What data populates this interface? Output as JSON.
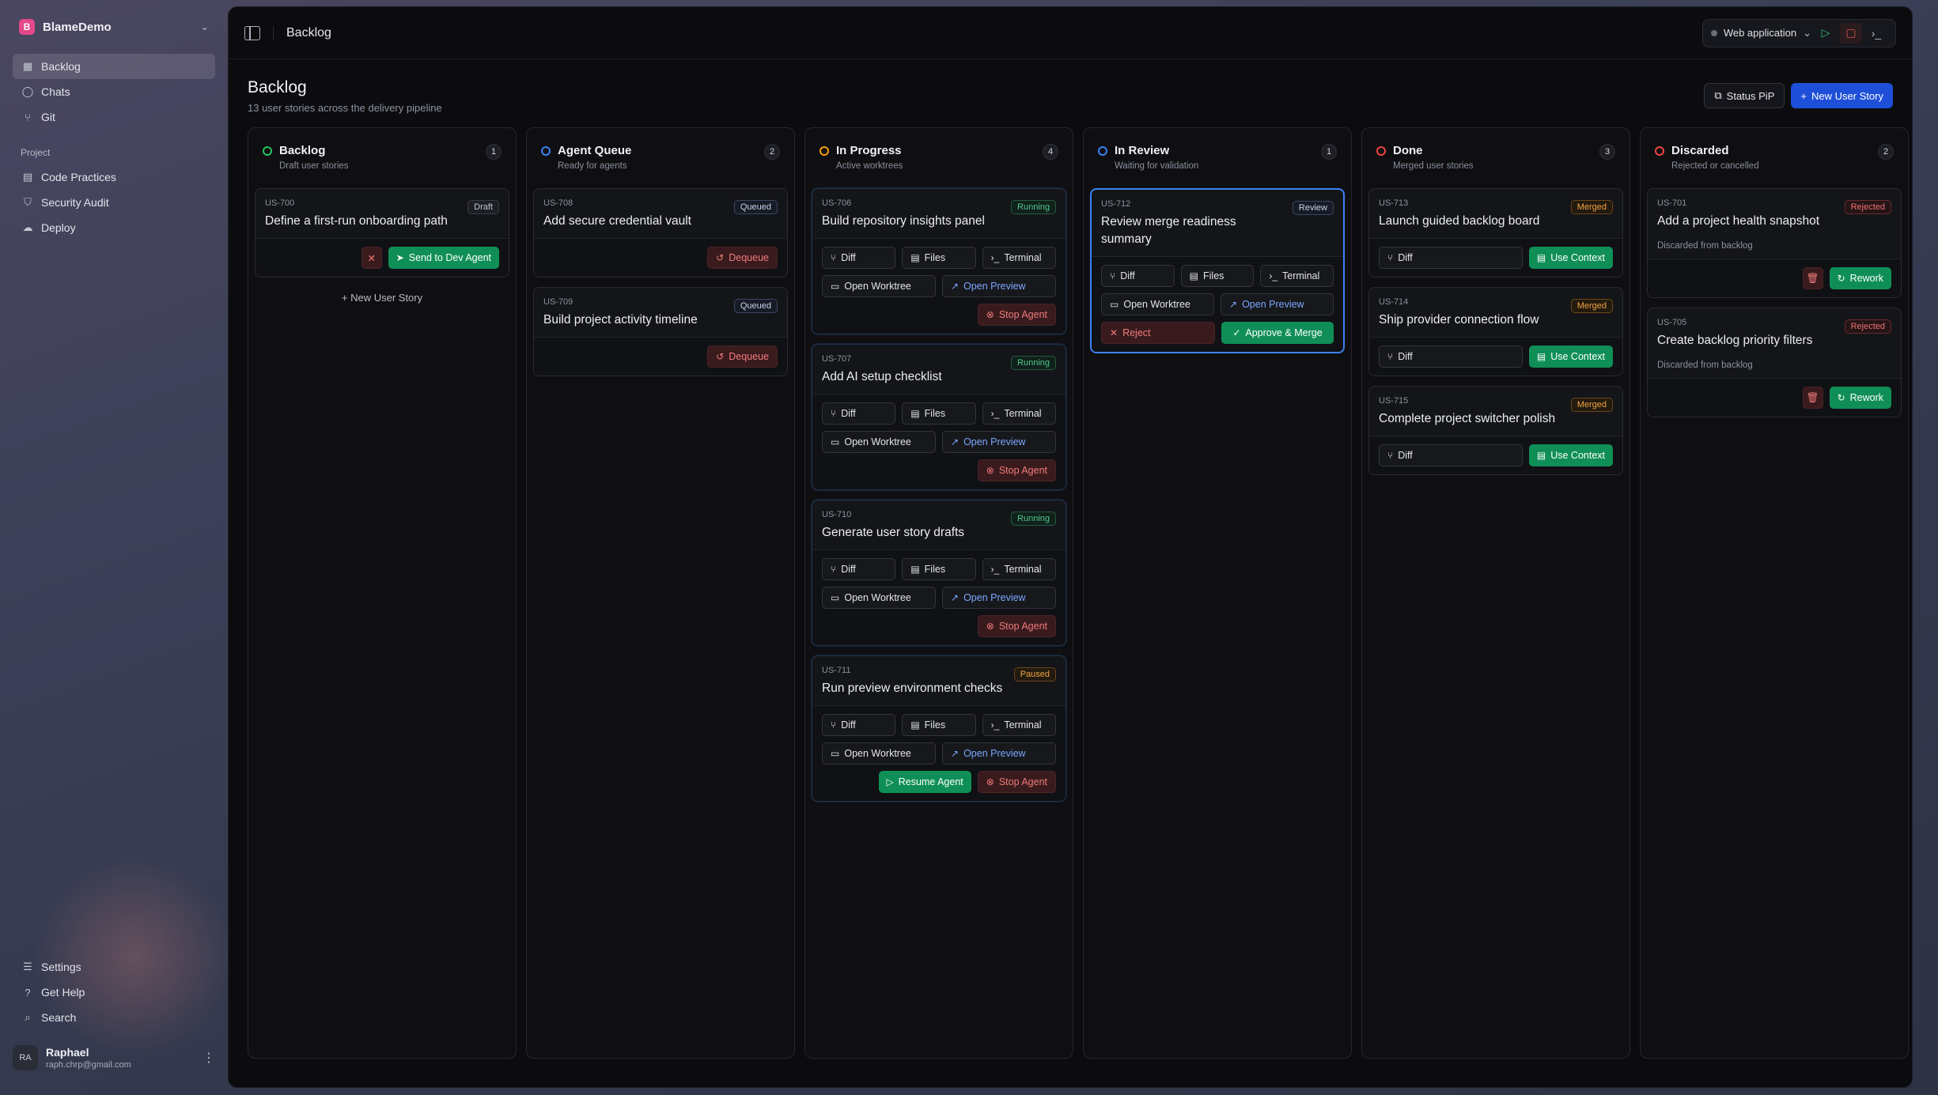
{
  "workspace": {
    "name": "BlameDemo",
    "logo_letter": "B"
  },
  "nav": {
    "items": [
      {
        "label": "Backlog",
        "icon": "board-icon"
      },
      {
        "label": "Chats",
        "icon": "chat-icon"
      },
      {
        "label": "Git",
        "icon": "git-icon"
      }
    ],
    "section_label": "Project",
    "project_items": [
      {
        "label": "Code Practices",
        "icon": "book-icon"
      },
      {
        "label": "Security Audit",
        "icon": "shield-icon"
      },
      {
        "label": "Deploy",
        "icon": "cloud-upload-icon"
      }
    ],
    "bottom_items": [
      {
        "label": "Settings",
        "icon": "sliders-icon"
      },
      {
        "label": "Get Help",
        "icon": "help-icon"
      },
      {
        "label": "Search",
        "icon": "search-icon"
      }
    ]
  },
  "user": {
    "initials": "RA",
    "name": "Raphael",
    "email": "raph.chrp@gmail.com"
  },
  "topbar": {
    "title": "Backlog",
    "environment": "Web application"
  },
  "page": {
    "title": "Backlog",
    "subtitle": "13 user stories across the delivery pipeline",
    "status_pip": "Status PiP",
    "new_story": "New User Story"
  },
  "labels": {
    "send_to_dev": "Send to Dev Agent",
    "new_user_story": "New User Story",
    "dequeue": "Dequeue",
    "diff": "Diff",
    "files": "Files",
    "terminal": "Terminal",
    "open_worktree": "Open Worktree",
    "open_preview": "Open Preview",
    "stop_agent": "Stop Agent",
    "resume_agent": "Resume Agent",
    "reject": "Reject",
    "approve_merge": "Approve & Merge",
    "use_context": "Use Context",
    "rework": "Rework",
    "discarded_note": "Discarded from backlog"
  },
  "columns": [
    {
      "title": "Backlog",
      "subtitle": "Draft user stories",
      "count": "1",
      "color": "#22c55e",
      "cards": [
        {
          "id": "US-700",
          "title": "Define a first-run onboarding path",
          "badge": "Draft"
        }
      ]
    },
    {
      "title": "Agent Queue",
      "subtitle": "Ready for agents",
      "count": "2",
      "color": "#3b82f6",
      "cards": [
        {
          "id": "US-708",
          "title": "Add secure credential vault",
          "badge": "Queued"
        },
        {
          "id": "US-709",
          "title": "Build project activity timeline",
          "badge": "Queued"
        }
      ]
    },
    {
      "title": "In Progress",
      "subtitle": "Active worktrees",
      "count": "4",
      "color": "#f59e0b",
      "cards": [
        {
          "id": "US-706",
          "title": "Build repository insights panel",
          "badge": "Running"
        },
        {
          "id": "US-707",
          "title": "Add AI setup checklist",
          "badge": "Running"
        },
        {
          "id": "US-710",
          "title": "Generate user story drafts",
          "badge": "Running"
        },
        {
          "id": "US-711",
          "title": "Run preview environment checks",
          "badge": "Paused"
        }
      ]
    },
    {
      "title": "In Review",
      "subtitle": "Waiting for validation",
      "count": "1",
      "color": "#3b82f6",
      "cards": [
        {
          "id": "US-712",
          "title": "Review merge readiness summary",
          "badge": "Review"
        }
      ]
    },
    {
      "title": "Done",
      "subtitle": "Merged user stories",
      "count": "3",
      "color": "#ef4444",
      "cards": [
        {
          "id": "US-713",
          "title": "Launch guided backlog board",
          "badge": "Merged"
        },
        {
          "id": "US-714",
          "title": "Ship provider connection flow",
          "badge": "Merged"
        },
        {
          "id": "US-715",
          "title": "Complete project switcher polish",
          "badge": "Merged"
        }
      ]
    },
    {
      "title": "Discarded",
      "subtitle": "Rejected or cancelled",
      "count": "2",
      "color": "#ef4444",
      "cards": [
        {
          "id": "US-701",
          "title": "Add a project health snapshot",
          "badge": "Rejected"
        },
        {
          "id": "US-705",
          "title": "Create backlog priority filters",
          "badge": "Rejected"
        }
      ]
    }
  ]
}
